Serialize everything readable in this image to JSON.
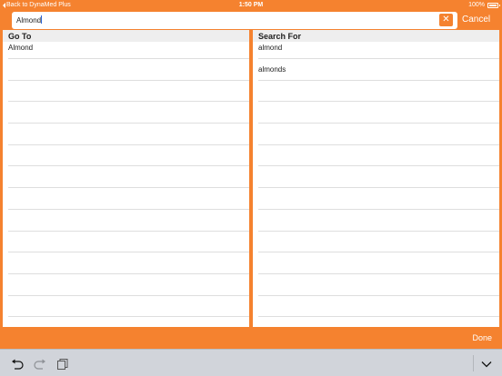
{
  "status_bar": {
    "back_label": "Back to DynaMed Plus",
    "time": "1:50 PM",
    "battery": "100%"
  },
  "search": {
    "value": "Almond",
    "clear_icon": "close-icon",
    "cancel_label": "Cancel"
  },
  "go_to": {
    "header": "Go To",
    "items": [
      "Almond"
    ]
  },
  "search_for": {
    "header": "Search For",
    "items": [
      "almond",
      "almonds"
    ]
  },
  "done_label": "Done",
  "keyboard_toolbar": {
    "icons": [
      "undo-icon",
      "redo-icon",
      "paste-icon",
      "chevron-down-icon"
    ]
  },
  "colors": {
    "accent": "#f5822f",
    "header_bg": "#eeeeee",
    "keyboard_bg": "#d1d4da"
  }
}
